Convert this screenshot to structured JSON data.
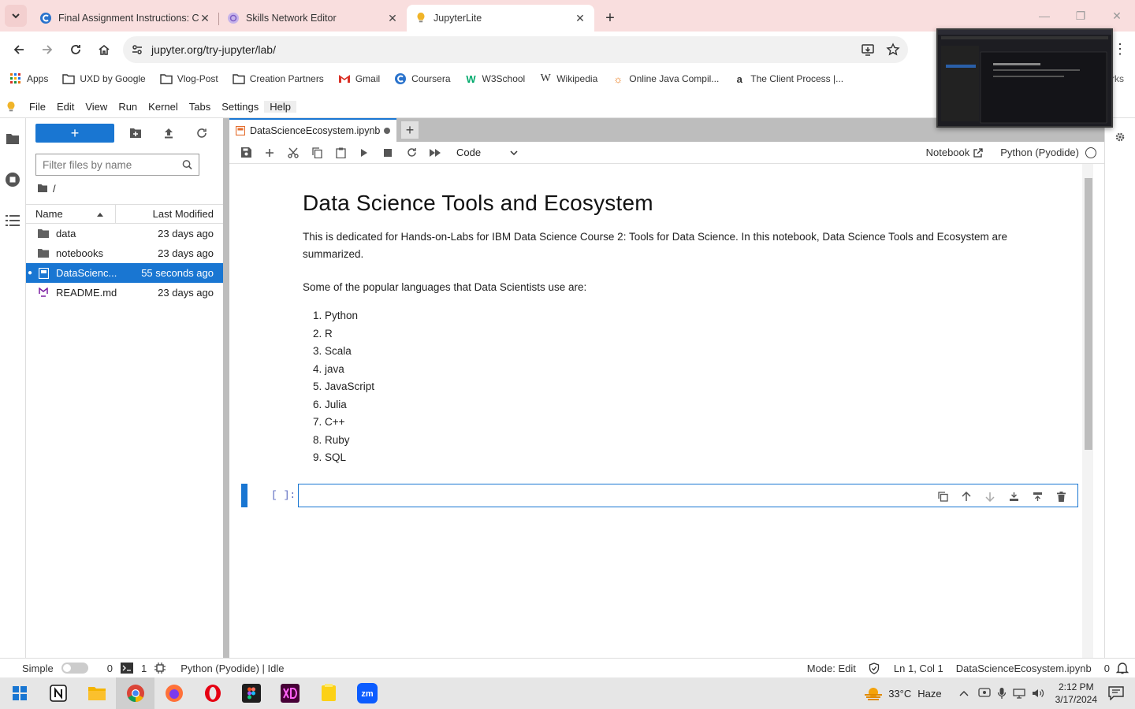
{
  "browser": {
    "tabs": [
      {
        "title": "Final Assignment Instructions: C",
        "favicon": "coursera-icon",
        "color": "#2a73cc"
      },
      {
        "title": "Skills Network Editor",
        "favicon": "skills-network-icon",
        "color": "#9a7bd1"
      },
      {
        "title": "JupyterLite",
        "favicon": "jupyterlite-icon",
        "color": "#f0b429"
      }
    ],
    "url": "jupyter.org/try-jupyter/lab/",
    "bookmarks": [
      {
        "label": "Apps",
        "icon": "apps-grid-icon"
      },
      {
        "label": "UXD by Google",
        "icon": "folder-icon"
      },
      {
        "label": "Vlog-Post",
        "icon": "folder-icon"
      },
      {
        "label": "Creation Partners",
        "icon": "folder-icon"
      },
      {
        "label": "Gmail",
        "icon": "gmail-icon"
      },
      {
        "label": "Coursera",
        "icon": "coursera-icon"
      },
      {
        "label": "W3School",
        "icon": "w3school-icon"
      },
      {
        "label": "Wikipedia",
        "icon": "wikipedia-icon"
      },
      {
        "label": "Online Java Compil...",
        "icon": "java-compiler-icon"
      },
      {
        "label": "The Client Process |...",
        "icon": "amazon-icon"
      }
    ],
    "bookmarks_overflow": "rks"
  },
  "jupyter": {
    "menu": [
      "File",
      "Edit",
      "View",
      "Run",
      "Kernel",
      "Tabs",
      "Settings",
      "Help"
    ],
    "filebrowser": {
      "filter_placeholder": "Filter files by name",
      "breadcrumb": "/",
      "columns": {
        "name": "Name",
        "modified": "Last Modified"
      },
      "files": [
        {
          "name": "data",
          "modified": "23 days ago",
          "type": "folder"
        },
        {
          "name": "notebooks",
          "modified": "23 days ago",
          "type": "folder"
        },
        {
          "name": "DataScienc...",
          "modified": "55 seconds ago",
          "type": "notebook"
        },
        {
          "name": "README.md",
          "modified": "23 days ago",
          "type": "markdown"
        }
      ]
    },
    "notebook": {
      "tab_title": "DataScienceEcosystem.ipynb",
      "cell_type": "Code",
      "notebook_label": "Notebook",
      "kernel": "Python (Pyodide)",
      "heading": "Data Science Tools and Ecosystem",
      "intro": "This is dedicated for Hands-on-Labs for IBM Data Science Course 2: Tools for Data Science. In this notebook, Data Science Tools and Ecosystem are summarized.",
      "languages_intro": "Some of the popular languages that Data Scientists use are:",
      "languages": [
        "Python",
        "R",
        "Scala",
        "java",
        "JavaScript",
        "Julia",
        "C++",
        "Ruby",
        "SQL"
      ],
      "prompt": "[ ]:"
    },
    "status": {
      "mode_label": "Simple",
      "terminals": "0",
      "kernels": "1",
      "kernel_status": "Python (Pyodide) | Idle",
      "mode": "Mode: Edit",
      "cursor": "Ln 1, Col 1",
      "filename": "DataScienceEcosystem.ipynb",
      "notifications": "0"
    }
  },
  "taskbar": {
    "weather_temp": "33°C",
    "weather_desc": "Haze",
    "time": "2:12 PM",
    "date": "3/17/2024"
  },
  "colors": {
    "accent": "#1976d2",
    "tabstrip": "#f9dede"
  }
}
